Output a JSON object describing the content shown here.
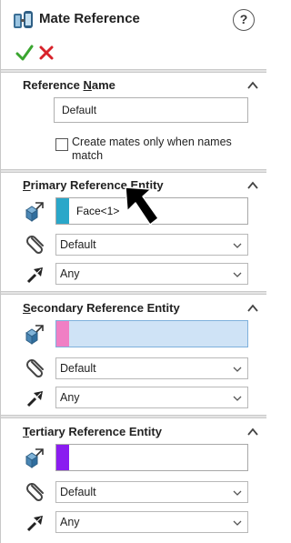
{
  "header": {
    "title": "Mate Reference",
    "help_label": "?"
  },
  "reference_name": {
    "title_prefix": "Reference ",
    "title_underlined": "N",
    "title_suffix": "ame",
    "value": "Default",
    "checkbox_label_line1": "Create mates only when names",
    "checkbox_label_line2": "match",
    "checkbox_checked": false
  },
  "sections": [
    {
      "title_underlined": "P",
      "title_rest": "rimary Reference Entity",
      "entity_value": "Face<1>",
      "swatch_color": "#2aa7c9",
      "active": false,
      "mate_type": "Default",
      "alignment": "Any"
    },
    {
      "title_underlined": "S",
      "title_rest": "econdary Reference Entity",
      "entity_value": "",
      "swatch_color": "#f07fc4",
      "active": true,
      "mate_type": "Default",
      "alignment": "Any"
    },
    {
      "title_underlined": "T",
      "title_rest": "ertiary Reference Entity",
      "entity_value": "",
      "swatch_color": "#8a1cf0",
      "active": false,
      "mate_type": "Default",
      "alignment": "Any"
    }
  ],
  "icons": {
    "title": "mate-reference-icon",
    "ok": "checkmark-icon",
    "cancel": "x-icon",
    "entity": "entity-select-icon",
    "mate_type": "paperclip-icon",
    "alignment": "alignment-arrow-icon",
    "collapse": "chevron-up-icon",
    "dropdown": "chevron-down-icon",
    "pointer": "mouse-pointer-icon"
  },
  "colors": {
    "ok_green": "#3aa52f",
    "cancel_red": "#d8222a",
    "active_field": "#cfe3f6"
  }
}
